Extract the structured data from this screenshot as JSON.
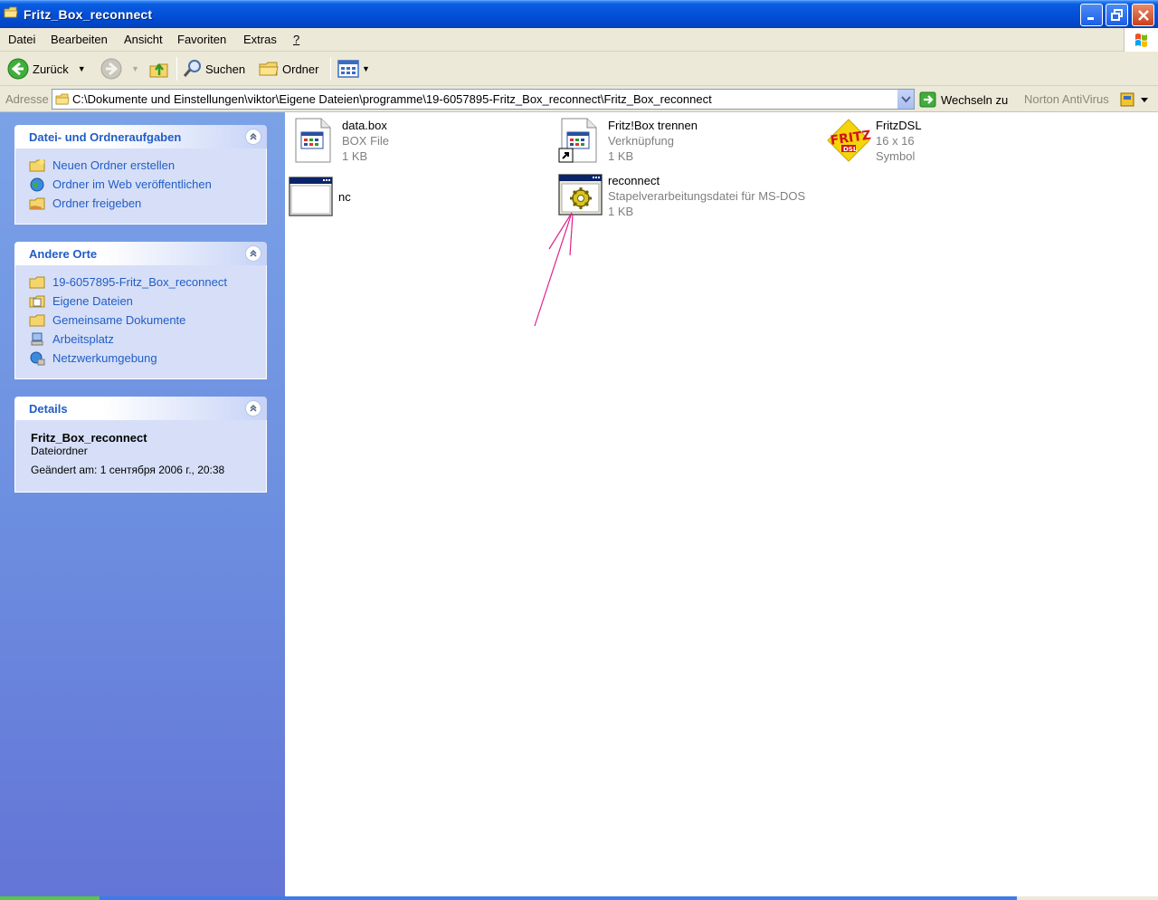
{
  "window": {
    "title": "Fritz_Box_reconnect"
  },
  "menu": {
    "items": [
      {
        "label": "Datei"
      },
      {
        "label": "Bearbeiten"
      },
      {
        "label": "Ansicht"
      },
      {
        "label": "Favoriten"
      },
      {
        "label": "Extras"
      },
      {
        "label": "?"
      }
    ]
  },
  "toolbar": {
    "back_label": "Zurück",
    "search_label": "Suchen",
    "folders_label": "Ordner"
  },
  "address": {
    "label": "Adresse",
    "path": "C:\\Dokumente und Einstellungen\\viktor\\Eigene Dateien\\programme\\19-6057895-Fritz_Box_reconnect\\Fritz_Box_reconnect",
    "go_label": "Wechseln zu",
    "norton_label": "Norton AntiVirus"
  },
  "sidebar": {
    "file_tasks": {
      "title": "Datei- und Ordneraufgaben",
      "items": [
        {
          "label": "Neuen Ordner erstellen"
        },
        {
          "label": "Ordner im Web veröffentlichen"
        },
        {
          "label": "Ordner freigeben"
        }
      ]
    },
    "other_places": {
      "title": "Andere Orte",
      "items": [
        {
          "label": "19-6057895-Fritz_Box_reconnect"
        },
        {
          "label": "Eigene Dateien"
        },
        {
          "label": "Gemeinsame Dokumente"
        },
        {
          "label": "Arbeitsplatz"
        },
        {
          "label": "Netzwerkumgebung"
        }
      ]
    },
    "details": {
      "title": "Details",
      "name": "Fritz_Box_reconnect",
      "type": "Dateiordner",
      "modified": "Geändert am: 1 сентября 2006 г., 20:38"
    }
  },
  "files": [
    {
      "name": "data.box",
      "line2": "BOX File",
      "line3": "1 KB",
      "icon": "app-file-icon"
    },
    {
      "name": "Fritz!Box trennen",
      "line2": "Verknüpfung",
      "line3": "1 KB",
      "icon": "shortcut-icon"
    },
    {
      "name": "FritzDSL",
      "line2": "16 x 16",
      "line3": "Symbol",
      "icon": "fritz-logo-icon"
    },
    {
      "name": "nc",
      "line2": "",
      "line3": "",
      "icon": "console-window-icon"
    },
    {
      "name": "reconnect",
      "line2": "Stapelverarbeitungsdatei für MS-DOS",
      "line3": "1 KB",
      "icon": "batch-file-icon"
    }
  ],
  "colors": {
    "titlebar": "#0450d8",
    "taskpane": "#6d8fe0",
    "link": "#215dc6",
    "annotation": "#e0208a"
  }
}
